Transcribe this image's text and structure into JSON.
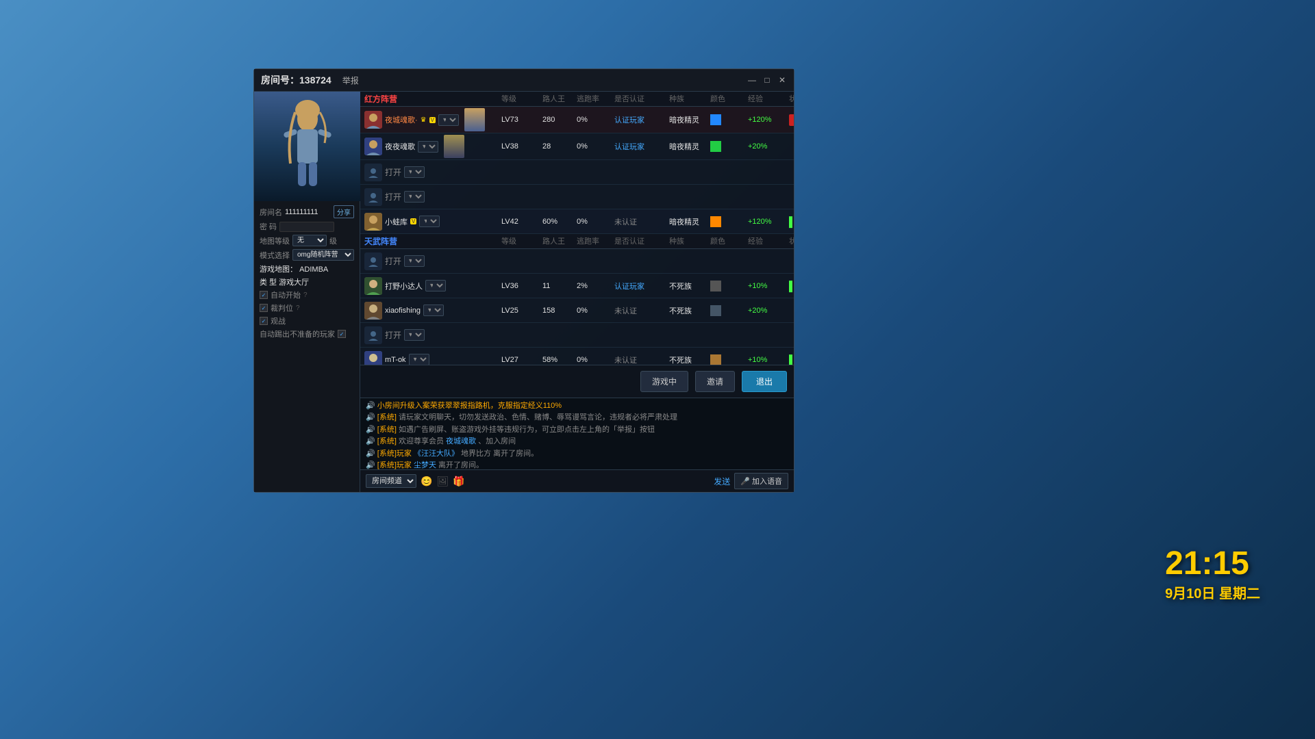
{
  "window": {
    "title": "房间号：138724",
    "report_label": "举报",
    "minimize": "—",
    "maximize": "□",
    "close": "✕"
  },
  "clock": {
    "time": "21:15",
    "date": "9月10日 星期二"
  },
  "sidebar": {
    "room_name_label": "房间名",
    "room_name_value": "111111111",
    "share_label": "分享",
    "pwd_label": "密 码",
    "map_label": "地图等级",
    "map_value": "无",
    "level_suffix": "级",
    "mode_label": "模式选择",
    "mode_value": "omg随机阵营",
    "game_address_label": "游戏地图：",
    "game_address_value": "ADIMBA",
    "game_type_label": "类 型",
    "game_type_value": "游戏大厅",
    "auto_start_label": "自动开始",
    "judge_label": "裁判位",
    "spectate_label": "观战",
    "auto_kick_label": "自动踢出不准备的玩家"
  },
  "columns": {
    "name": "",
    "level": "等级",
    "road": "路人王",
    "escape": "逃跑率",
    "auth": "是否认证",
    "race": "种族",
    "color": "颜色",
    "exp": "经验",
    "status": "状态"
  },
  "red_team": {
    "name": "红方阵营",
    "players": [
      {
        "avatar_color": "red",
        "name": "夜城魂歌·",
        "is_host": true,
        "vip": true,
        "level": "LV73",
        "road": "280",
        "escape": "0%",
        "auth": "认证玩家",
        "race": "暗夜精灵",
        "color": "#2288ff",
        "exp": "+120%",
        "exp_color": "green",
        "status": "状态",
        "has_portrait": true
      },
      {
        "avatar_color": "blue",
        "name": "夜夜魂歌",
        "is_host": false,
        "vip": false,
        "level": "LV38",
        "road": "28",
        "escape": "0%",
        "auth": "认证玩家",
        "race": "暗夜精灵",
        "color": "#22cc44",
        "exp": "+20%",
        "exp_color": "green",
        "status": "",
        "has_portrait": true
      },
      {
        "type": "open",
        "slot_label": "打开"
      },
      {
        "type": "open",
        "slot_label": "打开"
      }
    ]
  },
  "blue_team": {
    "name": "天武阵营",
    "players": [
      {
        "type": "open",
        "slot_label": "打开"
      },
      {
        "avatar_color": "green",
        "name": "打野小达人",
        "is_host": false,
        "vip": false,
        "level": "LV36",
        "road": "11",
        "escape": "2%",
        "auth": "认证玩家",
        "race": "不死族",
        "color": "#555555",
        "exp": "+10%",
        "exp_color": "green",
        "status": "",
        "has_portrait": false
      },
      {
        "avatar_color": "yellow",
        "name": "xiaofishing",
        "is_host": false,
        "vip": false,
        "level": "LV25",
        "road": "158",
        "escape": "0%",
        "auth": "未认证",
        "race": "不死族",
        "color": "#445566",
        "exp": "+20%",
        "exp_color": "green",
        "status": "",
        "has_portrait": false
      },
      {
        "type": "open",
        "slot_label": "打开"
      },
      {
        "avatar_color": "blue",
        "name": "mT-ok",
        "is_host": false,
        "vip": false,
        "level": "LV27",
        "road": "58%",
        "escape": "0%",
        "auth": "未认证",
        "race": "不死族",
        "color": "#aa7733",
        "exp": "+10%",
        "exp_color": "green",
        "status": "",
        "has_portrait": false
      }
    ]
  },
  "observer_player": {
    "avatar_color": "yellow",
    "name": "小蛙库",
    "vip": true,
    "level": "LV42",
    "road": "60%",
    "escape": "0%",
    "auth": "未认证",
    "race": "暗夜精灵",
    "color": "#ff8800",
    "exp": "+120%",
    "signal": "▌▌▌"
  },
  "buttons": {
    "ingame": "游戏中",
    "invite": "邀请",
    "quit": "退出"
  },
  "chat": {
    "channel_label": "房间频道",
    "send_label": "发送",
    "voice_label": "加入语音",
    "messages": [
      {
        "type": "highlight",
        "text": "小房间升级入案荣获翠翠报指路机，克服指定经义110%"
      },
      {
        "type": "system",
        "prefix": "[系统]",
        "text": "请玩家文明聊天，切勿发送政治、色情、赌博、辱骂谩骂言论，违规者必将严肃处理"
      },
      {
        "type": "system",
        "prefix": "[系统]",
        "text": "如遇广告刷屏、账盗游戏外挂等违规行为，可立即点击左上角的「举报」按钮"
      },
      {
        "type": "system",
        "prefix": "[系统]",
        "text": "欢迎尊享会员 夜城魂歌、加入房间"
      },
      {
        "type": "system",
        "prefix": "[系统]玩家",
        "player": "汪汪大队",
        "text": "地界比方 离开了房间。"
      },
      {
        "type": "system",
        "prefix": "[系统]玩家",
        "player": "尘梦天",
        "text": "离开了房间。"
      }
    ]
  }
}
